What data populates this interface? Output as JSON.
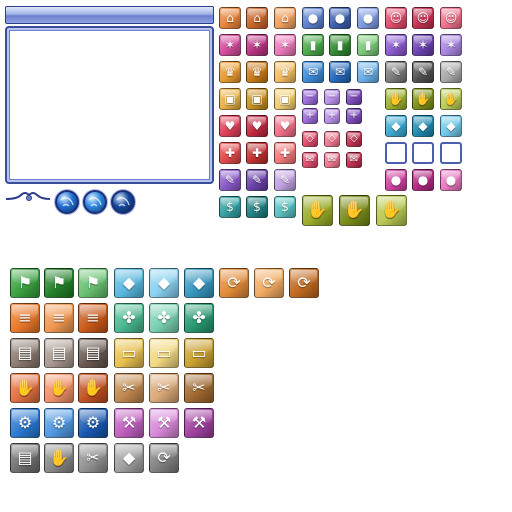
{
  "palette": {
    "frame_dark": "#2c3e8c",
    "frame_mid": "#6b7fcf",
    "frame_light": "#b8c4ef",
    "panel_fill": "#ffffff"
  },
  "orbs": [
    {
      "icon": "blue-globe-orb-icon",
      "color": "#1f6fd1"
    },
    {
      "icon": "blue-globe-orb-icon",
      "color": "#2c86e0"
    },
    {
      "icon": "blue-globe-orb-icon",
      "color": "#17489c"
    }
  ],
  "top_icons": [
    {
      "icon": "house-icon",
      "glyph": "⌂",
      "color": "#e8833a"
    },
    {
      "icon": "house-icon",
      "glyph": "⌂",
      "color": "#c9652a"
    },
    {
      "icon": "house-icon",
      "glyph": "⌂",
      "color": "#f0a060"
    },
    {
      "icon": "person-icon",
      "glyph": "●",
      "color": "#5a7fcf"
    },
    {
      "icon": "person-icon",
      "glyph": "●",
      "color": "#3a5fb0"
    },
    {
      "icon": "person-icon",
      "glyph": "●",
      "color": "#7c9ae0"
    },
    {
      "icon": "smiley-icon",
      "glyph": "☺",
      "color": "#e24a6a"
    },
    {
      "icon": "smiley-icon",
      "glyph": "☺",
      "color": "#c2304f"
    },
    {
      "icon": "smiley-icon",
      "glyph": "☺",
      "color": "#f0708a"
    },
    {
      "icon": "pin-icon",
      "glyph": "✶",
      "color": "#d24a9a"
    },
    {
      "icon": "pin-icon",
      "glyph": "✶",
      "color": "#b83282"
    },
    {
      "icon": "pin-icon",
      "glyph": "✶",
      "color": "#e878b8"
    },
    {
      "icon": "bar-chart-icon",
      "glyph": "▮",
      "color": "#4aa84a"
    },
    {
      "icon": "bar-chart-icon",
      "glyph": "▮",
      "color": "#2f8a2f"
    },
    {
      "icon": "bar-chart-icon",
      "glyph": "▮",
      "color": "#78c878"
    },
    {
      "icon": "pin-icon",
      "glyph": "✶",
      "color": "#8a5ad0"
    },
    {
      "icon": "pin-icon",
      "glyph": "✶",
      "color": "#6a40b0"
    },
    {
      "icon": "pin-icon",
      "glyph": "✶",
      "color": "#a884e0"
    },
    {
      "icon": "crown-icon",
      "glyph": "♛",
      "color": "#e89a30"
    },
    {
      "icon": "crown-icon",
      "glyph": "♛",
      "color": "#c87a18"
    },
    {
      "icon": "crown-icon",
      "glyph": "♛",
      "color": "#f2bc60"
    },
    {
      "icon": "envelope-icon",
      "glyph": "✉",
      "color": "#3a8ad8"
    },
    {
      "icon": "envelope-icon",
      "glyph": "✉",
      "color": "#2368b8"
    },
    {
      "icon": "envelope-icon",
      "glyph": "✉",
      "color": "#6aaee8"
    },
    {
      "icon": "pushpin-icon",
      "glyph": "✎",
      "color": "#7a7a7a"
    },
    {
      "icon": "pushpin-icon",
      "glyph": "✎",
      "color": "#505050"
    },
    {
      "icon": "pushpin-icon",
      "glyph": "✎",
      "color": "#a8a8a8"
    },
    {
      "icon": "treasure-chest-icon",
      "glyph": "▣",
      "color": "#e8b040"
    },
    {
      "icon": "treasure-chest-icon",
      "glyph": "▣",
      "color": "#c89020"
    },
    {
      "icon": "treasure-chest-icon",
      "glyph": "▣",
      "color": "#f2cc70"
    },
    {
      "icon": "handshake-icon",
      "glyph": "✋",
      "color": "#9ab030"
    },
    {
      "icon": "handshake-icon",
      "glyph": "✋",
      "color": "#7a9018"
    },
    {
      "icon": "handshake-icon",
      "glyph": "✋",
      "color": "#b8cc58"
    },
    {
      "icon": "heart-icon",
      "glyph": "♥",
      "color": "#e0405a"
    },
    {
      "icon": "heart-icon",
      "glyph": "♥",
      "color": "#c02840"
    },
    {
      "icon": "heart-icon",
      "glyph": "♥",
      "color": "#f07088"
    },
    {
      "icon": "cube-icon",
      "glyph": "◆",
      "color": "#3aa8d0"
    },
    {
      "icon": "cube-icon",
      "glyph": "◆",
      "color": "#2088b0"
    },
    {
      "icon": "cube-icon",
      "glyph": "◆",
      "color": "#70c8e8"
    },
    {
      "icon": "move-arrows-icon",
      "glyph": "✚",
      "color": "#e04848"
    },
    {
      "icon": "move-arrows-icon",
      "glyph": "✚",
      "color": "#c03030"
    },
    {
      "icon": "move-arrows-icon",
      "glyph": "✚",
      "color": "#f07878"
    },
    {
      "icon": "girl-icon",
      "glyph": "●",
      "color": "#d040a0"
    },
    {
      "icon": "girl-icon",
      "glyph": "●",
      "color": "#b02880"
    },
    {
      "icon": "girl-icon",
      "glyph": "●",
      "color": "#e878c0"
    },
    {
      "icon": "pushpin-icon",
      "glyph": "✎",
      "color": "#8a5ac8"
    },
    {
      "icon": "pushpin-icon",
      "glyph": "✎",
      "color": "#6a40a8"
    },
    {
      "icon": "pushpin-icon",
      "glyph": "✎",
      "color": "#c0a0e0"
    },
    {
      "icon": "money-icon",
      "glyph": "$",
      "color": "#30a0a0"
    },
    {
      "icon": "money-icon",
      "glyph": "$",
      "color": "#208080"
    },
    {
      "icon": "money-icon",
      "glyph": "$",
      "color": "#58c0c0"
    }
  ],
  "small_icons": [
    {
      "icon": "minus-icon",
      "glyph": "−",
      "color": "#9a6ad8"
    },
    {
      "icon": "minus-icon",
      "glyph": "−",
      "color": "#b890e8"
    },
    {
      "icon": "minus-icon",
      "glyph": "−",
      "color": "#7a4ab8"
    },
    {
      "icon": "plus-icon",
      "glyph": "+",
      "color": "#9a6ad8"
    },
    {
      "icon": "plus-icon",
      "glyph": "+",
      "color": "#b890e8"
    },
    {
      "icon": "plus-icon",
      "glyph": "+",
      "color": "#7a4ab8"
    },
    {
      "icon": "diamond-icon",
      "glyph": "◇",
      "color": "#e04a6a"
    },
    {
      "icon": "diamond-icon",
      "glyph": "◇",
      "color": "#f07890"
    },
    {
      "icon": "diamond-icon",
      "glyph": "◇",
      "color": "#c03050"
    },
    {
      "icon": "envelope-icon",
      "glyph": "✉",
      "color": "#e04a6a"
    },
    {
      "icon": "envelope-icon",
      "glyph": "✉",
      "color": "#f07890"
    },
    {
      "icon": "envelope-icon",
      "glyph": "✉",
      "color": "#c03050"
    }
  ],
  "large_handshake_icons": [
    {
      "icon": "handshake-icon",
      "glyph": "✋",
      "color": "#9aac28"
    },
    {
      "icon": "handshake-icon",
      "glyph": "✋",
      "color": "#7a8c18"
    },
    {
      "icon": "handshake-icon",
      "glyph": "✋",
      "color": "#b8c850"
    }
  ],
  "empty_slots": 3,
  "bottom_icons": [
    {
      "icon": "flag-icon",
      "glyph": "⚑",
      "color": "#3aa040"
    },
    {
      "icon": "flag-icon",
      "glyph": "⚑",
      "color": "#228028"
    },
    {
      "icon": "flag-icon",
      "glyph": "⚑",
      "color": "#68c070"
    },
    {
      "icon": "cube-icon",
      "glyph": "◆",
      "color": "#58b8e0"
    },
    {
      "icon": "cube-icon",
      "glyph": "◆",
      "color": "#88d0f0"
    },
    {
      "icon": "cube-icon",
      "glyph": "◆",
      "color": "#3898c0"
    },
    {
      "icon": "recycle-icon",
      "glyph": "⟳",
      "color": "#e08a38"
    },
    {
      "icon": "recycle-icon",
      "glyph": "⟳",
      "color": "#f0aa60"
    },
    {
      "icon": "recycle-icon",
      "glyph": "⟳",
      "color": "#c06820"
    },
    {
      "icon": "coins-icon",
      "glyph": "≡",
      "color": "#e8782a"
    },
    {
      "icon": "coins-icon",
      "glyph": "≡",
      "color": "#f09850"
    },
    {
      "icon": "coins-icon",
      "glyph": "≡",
      "color": "#c85818"
    },
    {
      "icon": "puzzle-icon",
      "glyph": "✤",
      "color": "#4ab890"
    },
    {
      "icon": "puzzle-icon",
      "glyph": "✤",
      "color": "#78d0b0"
    },
    {
      "icon": "puzzle-icon",
      "glyph": "✤",
      "color": "#289870"
    },
    {
      "icon": "book-icon",
      "glyph": "▤",
      "color": "#8a7a70"
    },
    {
      "icon": "book-icon",
      "glyph": "▤",
      "color": "#a89890"
    },
    {
      "icon": "book-icon",
      "glyph": "▤",
      "color": "#685850"
    },
    {
      "icon": "chest-icon",
      "glyph": "▭",
      "color": "#e8c050"
    },
    {
      "icon": "chest-icon",
      "glyph": "▭",
      "color": "#f2d880"
    },
    {
      "icon": "chest-icon",
      "glyph": "▭",
      "color": "#c8a030"
    },
    {
      "icon": "hand-icon",
      "glyph": "✋",
      "color": "#e07040"
    },
    {
      "icon": "hand-icon",
      "glyph": "✋",
      "color": "#f09068"
    },
    {
      "icon": "hand-icon",
      "glyph": "✋",
      "color": "#c05020"
    },
    {
      "icon": "scissors-icon",
      "glyph": "✂",
      "color": "#c08850"
    },
    {
      "icon": "scissors-icon",
      "glyph": "✂",
      "color": "#d8a878"
    },
    {
      "icon": "scissors-icon",
      "glyph": "✂",
      "color": "#a06830"
    },
    {
      "icon": "gear-icon",
      "glyph": "⚙",
      "color": "#2a78d0"
    },
    {
      "icon": "gear-icon",
      "glyph": "⚙",
      "color": "#5098e0"
    },
    {
      "icon": "gear-icon",
      "glyph": "⚙",
      "color": "#1858b0"
    },
    {
      "icon": "hammer-icon",
      "glyph": "⚒",
      "color": "#c060c0"
    },
    {
      "icon": "hammer-icon",
      "glyph": "⚒",
      "color": "#d888d8"
    },
    {
      "icon": "hammer-icon",
      "glyph": "⚒",
      "color": "#a040a0"
    },
    {
      "icon": "book-icon",
      "glyph": "▤",
      "color": "#707070"
    },
    {
      "icon": "hand-icon",
      "glyph": "✋",
      "color": "#888888"
    },
    {
      "icon": "scissors-icon",
      "glyph": "✂",
      "color": "#909090"
    },
    {
      "icon": "cube-icon",
      "glyph": "◆",
      "color": "#a0a0a0"
    },
    {
      "icon": "recycle-icon",
      "glyph": "⟳",
      "color": "#808080"
    }
  ]
}
